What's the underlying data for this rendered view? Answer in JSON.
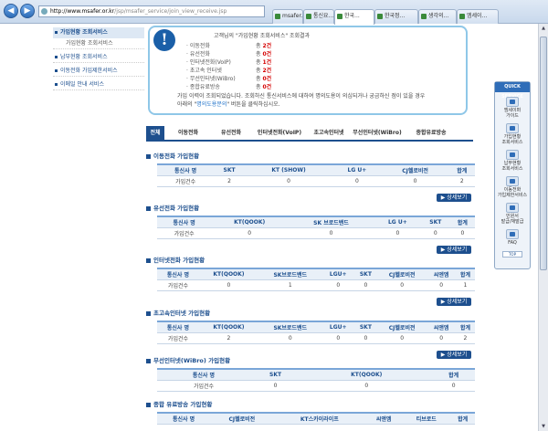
{
  "browser": {
    "url_host": "http://www.msafer.or.kr",
    "url_path": "/jsp/msafer_service/join_view_receive.jsp",
    "tabs": [
      {
        "label": "msafer..."
      },
      {
        "label": "통신요..."
      },
      {
        "label": "한국..."
      },
      {
        "label": "한국정..."
      },
      {
        "label": "생각의..."
      },
      {
        "label": "엠세이..."
      }
    ]
  },
  "sidebar": {
    "items": [
      {
        "label": "가입현황 조회서비스",
        "kind": "main"
      },
      {
        "label": "가입현황 조회서비스",
        "kind": "sub"
      },
      {
        "label": "납부현황 조회서비스",
        "kind": "sec"
      },
      {
        "label": "이동전화 가입제한서비스",
        "kind": "sec"
      },
      {
        "label": "이메일 안내 서비스",
        "kind": "sec"
      }
    ]
  },
  "summary": {
    "head": "고객님의 \"가입현황 조회서비스\" 조회결과",
    "rows": [
      {
        "key": "· 이동전화",
        "count_label": "총",
        "value": "2건"
      },
      {
        "key": "· 유선전화",
        "count_label": "총",
        "value": "0건"
      },
      {
        "key": "· 인터넷전화(VoIP)",
        "count_label": "총",
        "value": "1건"
      },
      {
        "key": "· 초고속 인터넷",
        "count_label": "총",
        "value": "2건"
      },
      {
        "key": "· 무선인터넷(WiBro)",
        "count_label": "총",
        "value": "0건"
      },
      {
        "key": "· 종합유료방송",
        "count_label": "총",
        "value": "0건"
      }
    ],
    "foot1": "가입 이력이 조회되었습니다.  조회하신 통신서비스에 대하여 명의도용이 의심되거나 궁금하신 점이 있을 경우",
    "foot2a": "아래의 \"",
    "foot2link": "명의도용문의",
    "foot2b": "\" 버튼을 클릭하십시오."
  },
  "service_tabs": [
    "전체",
    "이동전화",
    "유선전화",
    "인터넷전화(VoIP)",
    "초고속인터넷",
    "무선인터넷(WiBro)",
    "종합유료방송"
  ],
  "more_label": "▶ 상세보기",
  "sections": [
    {
      "title": "이동전화 가입현황",
      "headers": [
        "통신사 명",
        "SKT",
        "KT (SHOW)",
        "LG U+",
        "CJ헬로비전",
        "합계"
      ],
      "row": [
        "가입건수",
        "2",
        "0",
        "0",
        "0",
        "2"
      ]
    },
    {
      "title": "유선전화 가입현황",
      "headers": [
        "통신사 명",
        "KT(QOOK)",
        "SK 브로드밴드",
        "LG U+",
        "SKT",
        "합계"
      ],
      "row": [
        "가입건수",
        "0",
        "0",
        "0",
        "0",
        "0"
      ]
    },
    {
      "title": "인터넷전화 가입현황",
      "headers": [
        "통신사 명",
        "KT(QOOK)",
        "SK브로드밴드",
        "LGU+",
        "SKT",
        "CJ헬로비전",
        "씨엔엠",
        "합계"
      ],
      "row": [
        "가입건수",
        "0",
        "1",
        "0",
        "0",
        "0",
        "0",
        "1"
      ]
    },
    {
      "title": "초고속인터넷 가입현황",
      "headers": [
        "통신사 명",
        "KT(QOOK)",
        "SK브로드밴드",
        "LGU+",
        "SKT",
        "CJ헬로비전",
        "씨앤엠",
        "합계"
      ],
      "row": [
        "가입건수",
        "2",
        "0",
        "0",
        "0",
        "0",
        "0",
        "2"
      ]
    },
    {
      "title": "무선인터넷(WiBro) 가입현황",
      "headers": [
        "통신사 명",
        "SKT",
        "KT(QOOK)",
        "합계"
      ],
      "row": [
        "가입건수",
        "0",
        "0",
        "0"
      ]
    },
    {
      "title": "종합 유료방송 가입현황",
      "headers": [
        "통신사 명",
        "CJ헬로비전",
        "KT스카이라이프",
        "씨앤엠",
        "티브로드",
        "합계"
      ],
      "row": []
    }
  ],
  "quick": {
    "title": "QUICK SERVICE",
    "items": [
      {
        "label1": "엠세이퍼",
        "label2": "가이드",
        "icon": "guide-icon"
      },
      {
        "label1": "가입현황",
        "label2": "조회서비스",
        "icon": "join-status-icon"
      },
      {
        "label1": "납부현황",
        "label2": "조회서비스",
        "icon": "payment-status-icon"
      },
      {
        "label1": "이동전화",
        "label2": "가입제한서비스",
        "icon": "restriction-icon"
      },
      {
        "label1": "민원서",
        "label2": "발급/재발급",
        "icon": "document-icon"
      },
      {
        "label1": "FAQ",
        "label2": "",
        "icon": "faq-icon"
      }
    ],
    "top": "TOP"
  }
}
